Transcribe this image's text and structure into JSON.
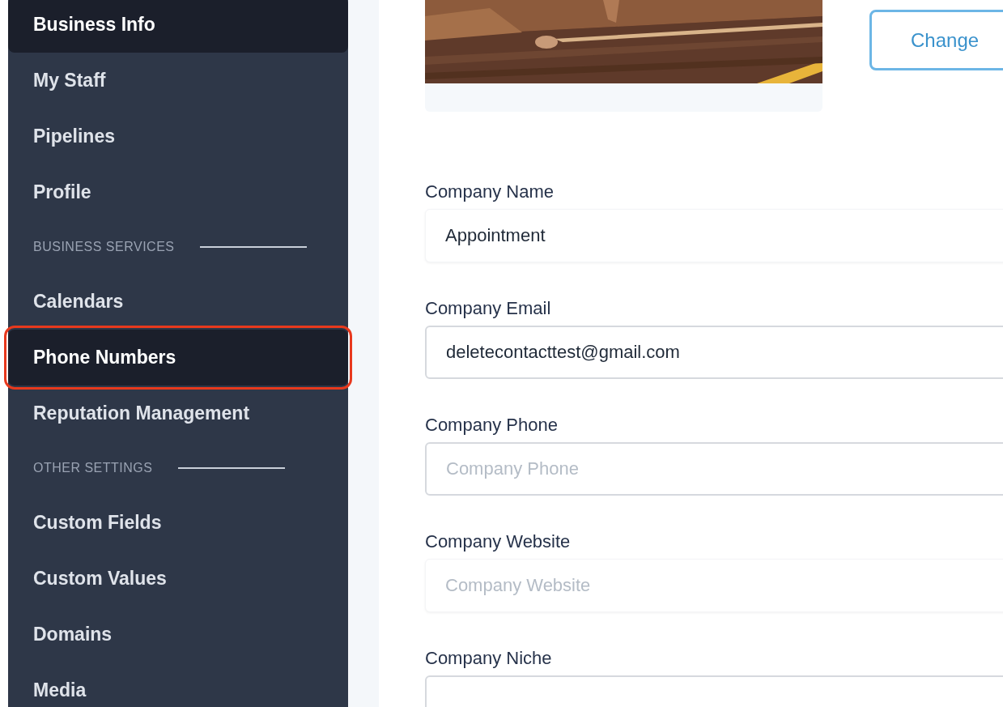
{
  "sidebar": {
    "items": [
      {
        "kind": "link",
        "label": "Business Info",
        "selected": true,
        "outlined": false
      },
      {
        "kind": "link",
        "label": "My Staff",
        "selected": false,
        "outlined": false
      },
      {
        "kind": "link",
        "label": "Pipelines",
        "selected": false,
        "outlined": false
      },
      {
        "kind": "link",
        "label": "Profile",
        "selected": false,
        "outlined": false
      },
      {
        "kind": "section",
        "label": "BUSINESS SERVICES"
      },
      {
        "kind": "link",
        "label": "Calendars",
        "selected": false,
        "outlined": false
      },
      {
        "kind": "link",
        "label": "Phone Numbers",
        "selected": true,
        "outlined": true
      },
      {
        "kind": "link",
        "label": "Reputation Management",
        "selected": false,
        "outlined": false
      },
      {
        "kind": "section",
        "label": "OTHER SETTINGS"
      },
      {
        "kind": "link",
        "label": "Custom Fields",
        "selected": false,
        "outlined": false
      },
      {
        "kind": "link",
        "label": "Custom Values",
        "selected": false,
        "outlined": false
      },
      {
        "kind": "link",
        "label": "Domains",
        "selected": false,
        "outlined": false
      },
      {
        "kind": "link",
        "label": "Media",
        "selected": false,
        "outlined": false
      }
    ]
  },
  "logo": {
    "kind": "picture",
    "button": "Change"
  },
  "fields": [
    {
      "label": "Company Name",
      "kind": "plain",
      "value": "Appointment"
    },
    {
      "label": "Company Email",
      "kind": "bordered",
      "value": "deletecontacttest@gmail.com"
    },
    {
      "label": "Company Phone",
      "kind": "bordered",
      "placeholder": "Company Phone"
    },
    {
      "label": "Company Website",
      "kind": "plain",
      "placeholder": "Company Website"
    },
    {
      "label": "Company Niche",
      "kind": "bordered"
    }
  ]
}
